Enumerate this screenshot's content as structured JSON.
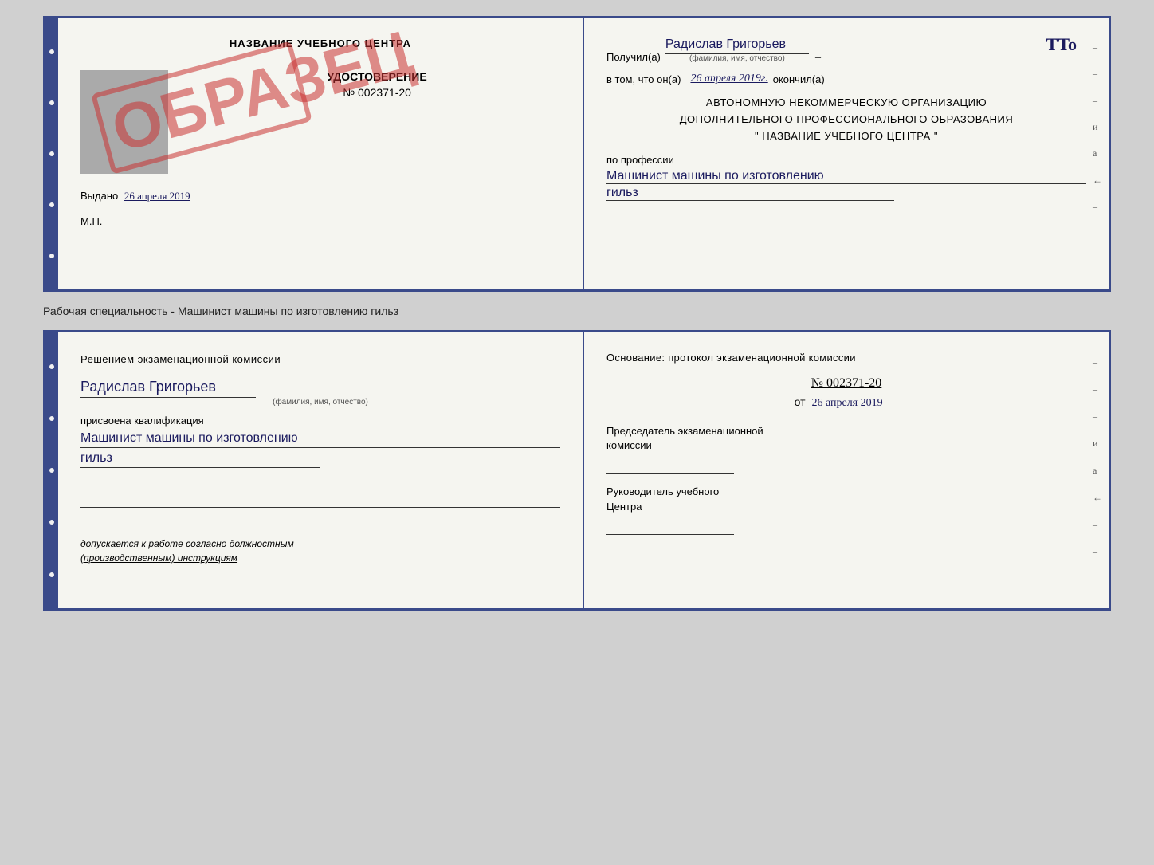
{
  "top_document": {
    "left_page": {
      "title": "НАЗВАНИЕ УЧЕБНОГО ЦЕНТРА",
      "cert_label": "УДОСТОВЕРЕНИЕ",
      "cert_number": "№ 002371-20",
      "issued_prefix": "Выдано",
      "issued_date": "26 апреля 2019",
      "mp_label": "М.П.",
      "watermark": "ОБРАЗЕЦ"
    },
    "right_page": {
      "received_prefix": "Получил(а)",
      "recipient_name": "Радислав Григорьев",
      "name_subtext": "(фамилия, имя, отчество)",
      "completed_prefix": "в том, что он(а)",
      "completed_date": "26 апреля 2019г.",
      "completed_suffix": "окончил(а)",
      "org_line1": "АВТОНОМНУЮ НЕКОММЕРЧЕСКУЮ ОРГАНИЗАЦИЮ",
      "org_line2": "ДОПОЛНИТЕЛЬНОГО ПРОФЕССИОНАЛЬНОГО ОБРАЗОВАНИЯ",
      "org_line3": "\" НАЗВАНИЕ УЧЕБНОГО ЦЕНТРА \"",
      "profession_label": "по профессии",
      "profession_value1": "Машинист машины по изготовлению",
      "profession_value2": "гильз",
      "dash1": "–",
      "dash2": "–",
      "dash3": "–",
      "side_chars": [
        "и",
        "а",
        "←",
        "–",
        "–",
        "–"
      ]
    }
  },
  "separator_label": "Рабочая специальность - Машинист машины по изготовлению гильз",
  "bottom_document": {
    "left_page": {
      "decision_text": "Решением экзаменационной комиссии",
      "name": "Радислав Григорьев",
      "name_subtext": "(фамилия, имя, отчество)",
      "qualification_prefix": "присвоена квалификация",
      "qualification_line1": "Машинист машины по изготовлению",
      "qualification_line2": "гильз",
      "admission_text": "допускается к",
      "admission_underline": "работе согласно должностным",
      "admission_underline2": "(производственным) инструкциям"
    },
    "right_page": {
      "basis_text": "Основание: протокол экзаменационной комиссии",
      "protocol_number": "№ 002371-20",
      "date_prefix": "от",
      "date_value": "26 апреля 2019",
      "chairman_label": "Председатель экзаменационной",
      "chairman_label2": "комиссии",
      "director_label": "Руководитель учебного",
      "director_label2": "Центра",
      "dash1": "–",
      "dash2": "–",
      "dash3": "–",
      "side_chars": [
        "и",
        "а",
        "←",
        "–",
        "–",
        "–"
      ]
    }
  }
}
